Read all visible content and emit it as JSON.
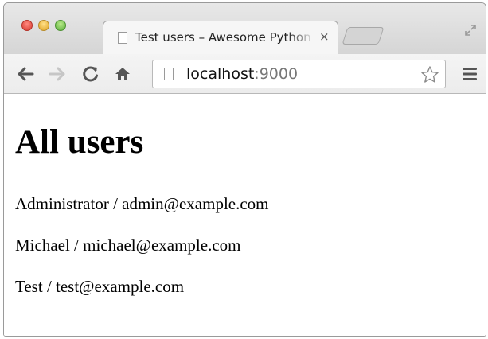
{
  "browser": {
    "tab_title": "Test users – Awesome Python",
    "tab_close": "×",
    "url_host": "localhost",
    "url_port": ":9000"
  },
  "page": {
    "heading": "All users",
    "users": [
      "Administrator / admin@example.com",
      "Michael / michael@example.com",
      "Test / test@example.com"
    ]
  }
}
